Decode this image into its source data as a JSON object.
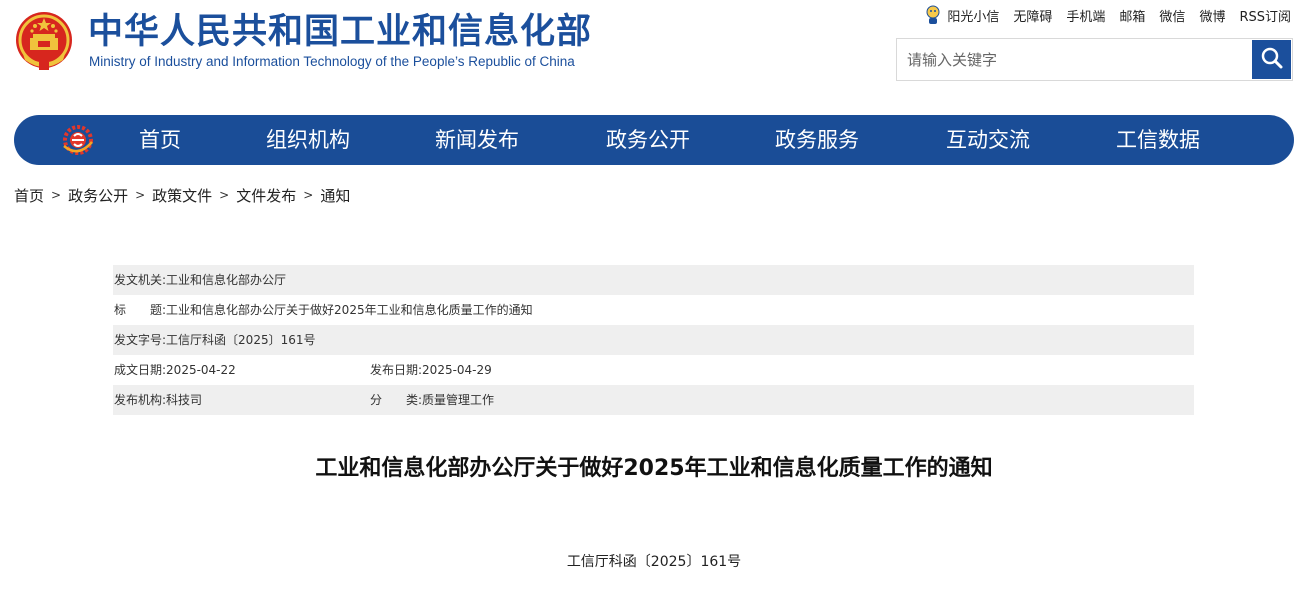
{
  "header": {
    "title_zh": "中华人民共和国工业和信息化部",
    "title_en": "Ministry of Industry and Information Technology of the People’s Republic of China",
    "emblem_icon": "national-emblem-icon"
  },
  "toplinks": [
    {
      "label": "阳光小信",
      "icon": "mascot-icon"
    },
    {
      "label": "无障碍"
    },
    {
      "label": "手机端"
    },
    {
      "label": "邮箱"
    },
    {
      "label": "微信"
    },
    {
      "label": "微博"
    },
    {
      "label": "RSS订阅"
    }
  ],
  "search": {
    "placeholder": "请输入关键字",
    "value": "",
    "button_icon": "search-icon"
  },
  "nav": {
    "logo_icon": "miit-logo-icon",
    "items": [
      "首页",
      "组织机构",
      "新闻发布",
      "政务公开",
      "政务服务",
      "互动交流",
      "工信数据"
    ]
  },
  "breadcrumb": [
    "首页",
    "政务公开",
    "政策文件",
    "文件发布",
    "通知"
  ],
  "info": {
    "issuer_label": "发文机关:",
    "issuer": "工业和信息化部办公厅",
    "title_label": "标　　题:",
    "title": "工业和信息化部办公厅关于做好2025年工业和信息化质量工作的通知",
    "docno_label": "发文字号:",
    "docno": "工信厅科函〔2025〕161号",
    "written_label": "成文日期:",
    "written": "2025-04-22",
    "published_label": "发布日期:",
    "published": "2025-04-29",
    "org_label": "发布机构:",
    "org": "科技司",
    "category_label": "分　　类:",
    "category": "质量管理工作"
  },
  "document": {
    "title": "工业和信息化部办公厅关于做好2025年工业和信息化质量工作的通知",
    "number": "工信厅科函〔2025〕161号"
  },
  "colors": {
    "brand_blue": "#1a4d97",
    "row_shade": "#efefef"
  }
}
